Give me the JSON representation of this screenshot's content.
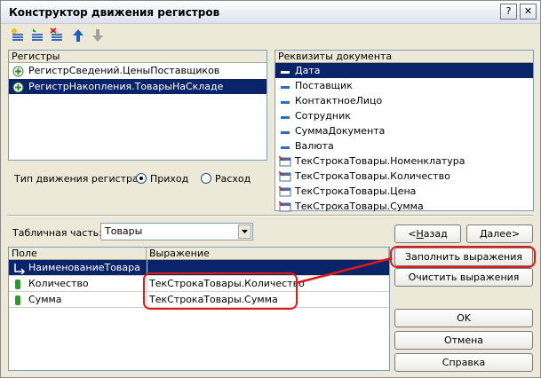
{
  "window": {
    "title": "Конструктор движения регистров"
  },
  "title_buttons": {
    "help": "?",
    "close": "✕"
  },
  "registers": {
    "header": "Регистры",
    "items": [
      {
        "label": "РегистрСведений.ЦеныПоставщиков",
        "selected": false
      },
      {
        "label": "РегистрНакопления.ТоварыНаСкладе",
        "selected": true
      }
    ]
  },
  "movement": {
    "label": "Тип движения регистра:",
    "income": "Приход",
    "expense": "Расход",
    "selected": "income"
  },
  "requisites": {
    "header": "Реквизиты документа",
    "items": [
      {
        "label": "Дата",
        "kind": "attr",
        "selected": true
      },
      {
        "label": "Поставщик",
        "kind": "attr"
      },
      {
        "label": "КонтактноеЛицо",
        "kind": "attr"
      },
      {
        "label": "Сотрудник",
        "kind": "attr"
      },
      {
        "label": "СуммаДокумента",
        "kind": "attr"
      },
      {
        "label": "Валюта",
        "kind": "attr"
      },
      {
        "label": "ТекСтрокаТовары.Номенклатура",
        "kind": "tab"
      },
      {
        "label": "ТекСтрокаТовары.Количество",
        "kind": "tab"
      },
      {
        "label": "ТекСтрокаТовары.Цена",
        "kind": "tab"
      },
      {
        "label": "ТекСтрокаТовары.Сумма",
        "kind": "tab"
      }
    ]
  },
  "tabular": {
    "label": "Табличная часть:",
    "value": "Товары"
  },
  "nav": {
    "back": "Назад",
    "back_key": "Н",
    "back_rest": "азад",
    "next": "Далее",
    "next_key": "Д",
    "next_rest": "алее",
    "back_prefix": "<",
    "next_suffix": ">"
  },
  "grid": {
    "columns": [
      "Поле",
      "Выражение"
    ],
    "rows": [
      {
        "field": "НаименованиеТовара",
        "expr": "",
        "selected": true,
        "kind": "dim"
      },
      {
        "field": "Количество",
        "expr": "ТекСтрокаТовары.Количество",
        "kind": "res"
      },
      {
        "field": "Сумма",
        "expr": "ТекСтрокаТовары.Сумма",
        "kind": "res"
      }
    ]
  },
  "buttons": {
    "fill": "Заполнить выражения",
    "clear": "Очистить выражения",
    "ok": "OK",
    "cancel": "Отмена",
    "help": "Справка"
  },
  "colors": {
    "selection": "#0a246a",
    "highlight": "#e01818",
    "panel_border": "#7f9db9"
  }
}
